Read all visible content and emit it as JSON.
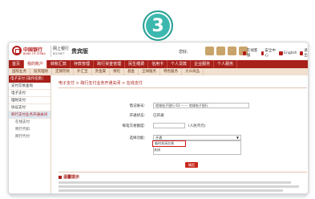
{
  "step_number": "3",
  "header": {
    "bank_name_cn": "中国银行",
    "bank_name_en": "BANK OF CHINA",
    "service_cn": "网上银行",
    "service_en": "BOCNET",
    "title": "贵宾版",
    "greeting": "您好,",
    "links": [
      "在线客服",
      "安全中心",
      "English",
      "退出"
    ]
  },
  "nav": {
    "items": [
      "首页",
      "我的账户",
      "转账汇款",
      "存款管理",
      "跨行资金管理",
      "民生缴费",
      "信用卡",
      "个人贷款",
      "企业服务",
      "个人服务"
    ],
    "active_index": 1
  },
  "subnav": {
    "items": [
      "国际业务",
      "投资理财",
      "定期存款",
      "外汇宝",
      "贵金属",
      "保险",
      "基金",
      "全球服务",
      "特色服务",
      "大众商品"
    ]
  },
  "sidebar": {
    "header": "电子支付 [操作指南]",
    "items": [
      "支付交易查询",
      "电子支付",
      "理财支付",
      "协议支付",
      "跨行支付业务开通关闭",
      "在线支付",
      "跨行代扣",
      "跨行代付"
    ],
    "active_index": 4
  },
  "breadcrumb": "电子支付 > 跨行支付业务开通关闭 > 在线支付",
  "form": {
    "debit_card_label": "借记账号:",
    "debit_card_value": "地域电子银行 63  ·······  地域电子银行",
    "status_label": "开通状态:",
    "status_value": "已开通",
    "limit_label": "每笔交易额度:",
    "limit_value": "(人民币元)",
    "mode_label": "选择功能:",
    "mode_value": "开通",
    "options": [
      "临时关闭交易",
      "关闭"
    ],
    "confirm_label": "确定"
  },
  "notice": {
    "title": "温馨提示"
  }
}
